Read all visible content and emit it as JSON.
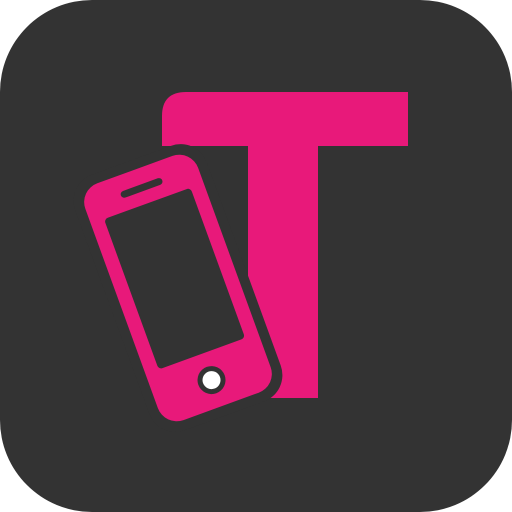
{
  "app_icon": {
    "icon": "letter-t-with-phone-icon",
    "colors": {
      "tile_background": "#333333",
      "accent_magenta": "#E8197A"
    }
  }
}
